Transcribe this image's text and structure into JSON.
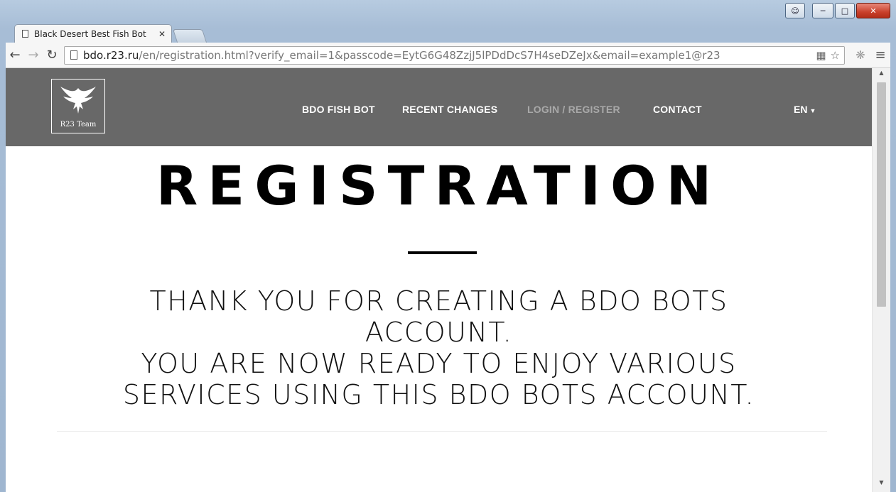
{
  "browser": {
    "tab_title": "Black Desert Best Fish Bot",
    "url_host": "bdo.r23.ru",
    "url_rest": "/en/registration.html?verify_email=1&passcode=EytG6G48ZzjJ5lPDdDcS7H4seDZeJx&email=example1@r23",
    "icons": [
      "page-icon",
      "back-arrow-icon",
      "forward-arrow-icon",
      "reload-icon",
      "translate-icon",
      "star-icon",
      "extension-icon",
      "menu-icon",
      "user-icon",
      "minimize-icon",
      "maximize-icon",
      "close-icon"
    ]
  },
  "site": {
    "logo_text": "R23 Team",
    "nav": {
      "fish_bot": "BDO FISH BOT",
      "recent_changes": "RECENT CHANGES",
      "login_register": "LOGIN / REGISTER",
      "contact": "CONTACT",
      "language": "EN"
    }
  },
  "main": {
    "title": "REGISTRATION",
    "message_line1": "Thank you for creating a BDO Bots",
    "message_line2": "account.",
    "message_line3": "You are now ready to enjoy various",
    "message_line4": "services using this BDO Bots account."
  },
  "colors": {
    "nav_background": "#686868",
    "nav_active": "#a9a9a9"
  }
}
